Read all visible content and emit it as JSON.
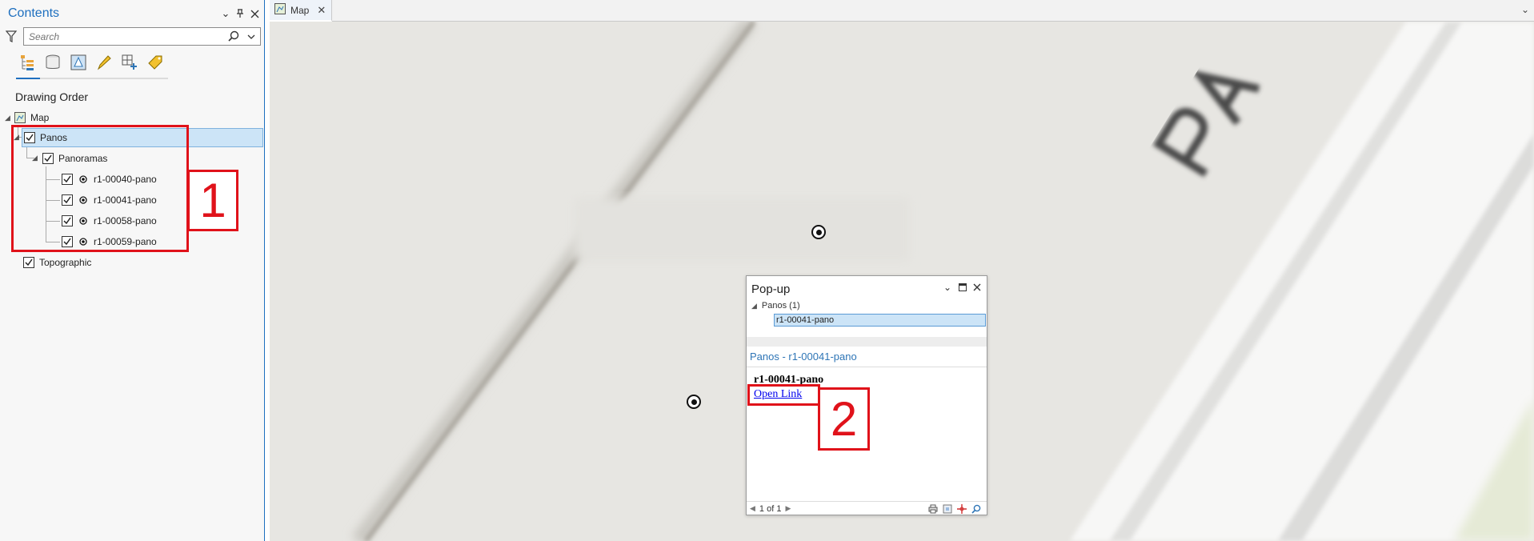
{
  "contents": {
    "title": "Contents",
    "search_placeholder": "Search",
    "section_title": "Drawing Order",
    "tree": {
      "map_label": "Map",
      "panos_label": "Panos",
      "panoramas_label": "Panoramas",
      "pano_items": [
        "r1-00040-pano",
        "r1-00041-pano",
        "r1-00058-pano",
        "r1-00059-pano"
      ],
      "topographic_label": "Topographic"
    },
    "toolbar_icons": [
      "list-by-drawing-order-icon",
      "list-by-source-icon",
      "list-by-selection-icon",
      "list-by-editing-icon",
      "list-by-snapping-icon",
      "list-by-labeling-icon"
    ]
  },
  "annotations": {
    "box1_label": "1",
    "box2_label": "2"
  },
  "map": {
    "tab_label": "Map"
  },
  "popup": {
    "title": "Pop-up",
    "layer_label": "Panos  (1)",
    "feature_label": "r1-00041-pano",
    "subtitle": "Panos - r1-00041-pano",
    "name": "r1-00041-pano",
    "link_text": "Open Link",
    "pager": "1 of 1"
  },
  "colors": {
    "accent": "#1e6fbf",
    "annotation_red": "#e0121a",
    "selection": "#cce4f7",
    "map_background": "#e6e5e2"
  }
}
